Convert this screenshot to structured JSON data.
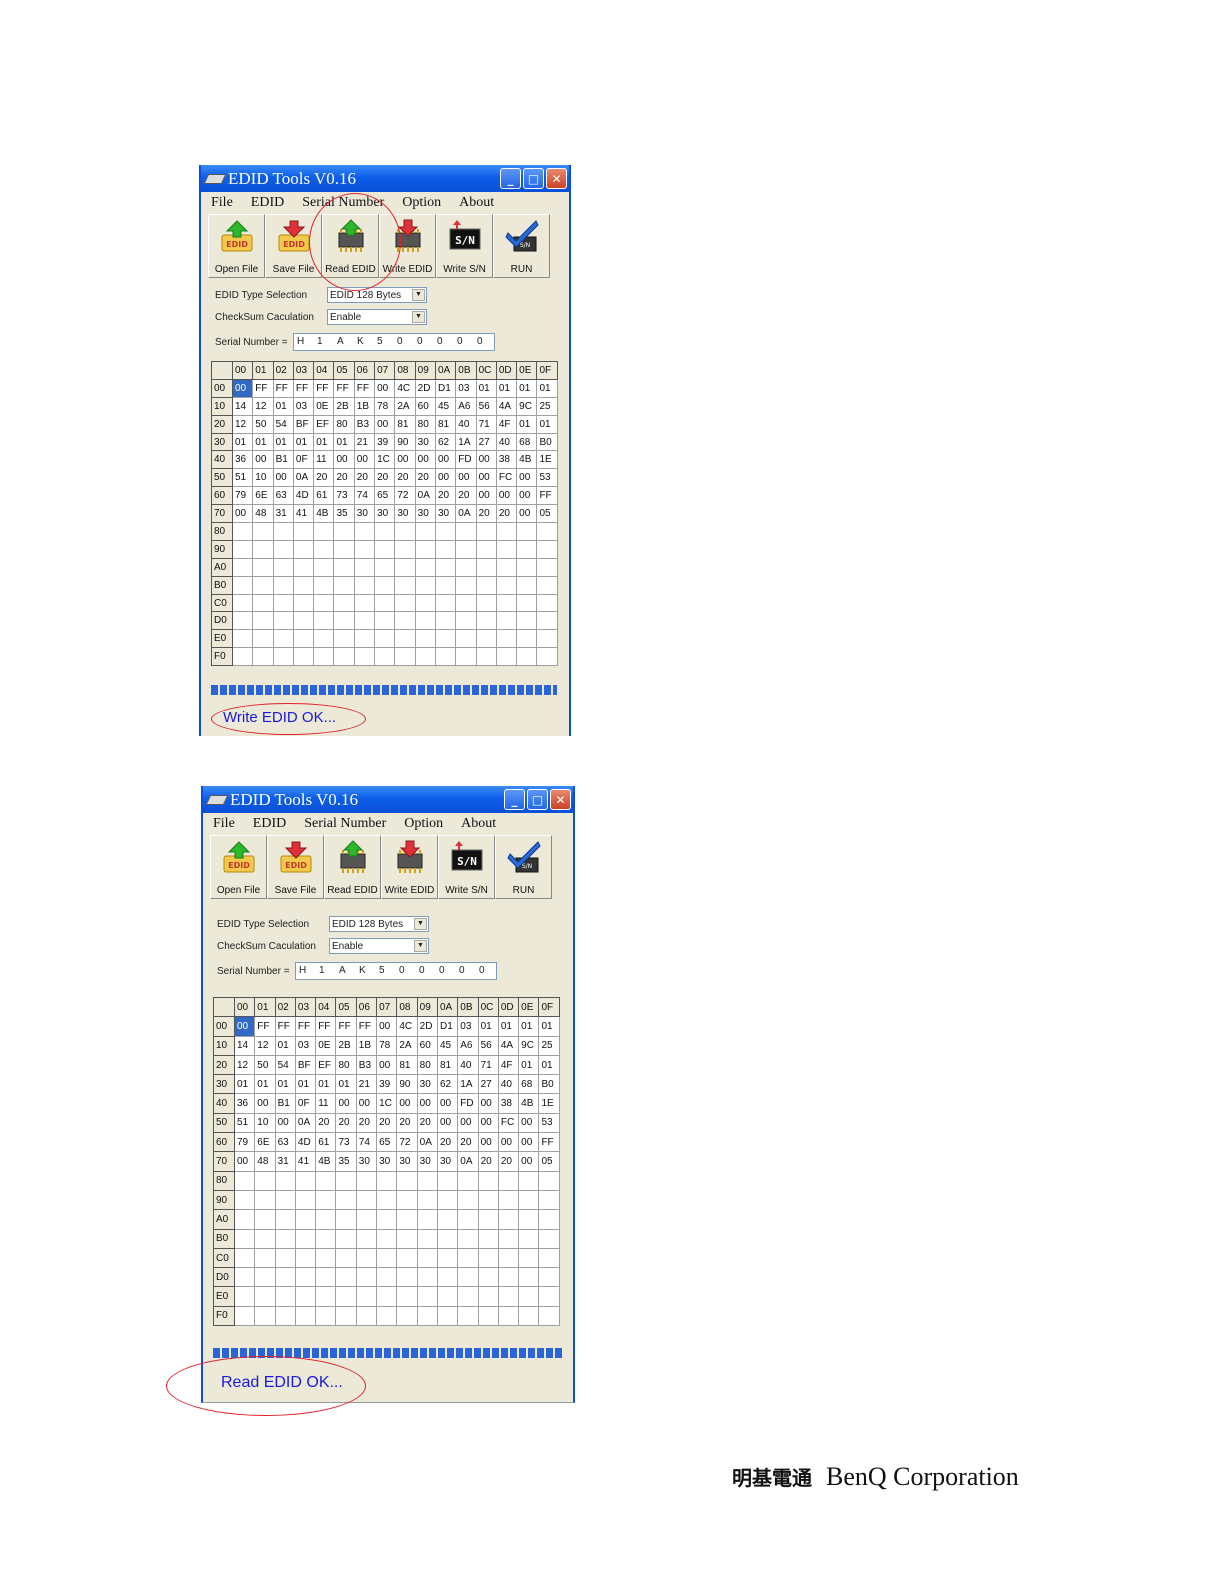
{
  "window_title": "EDID Tools V0.16",
  "menu": [
    "File",
    "EDID",
    "Serial Number",
    "Option",
    "About"
  ],
  "toolbar": [
    "Open File",
    "Save File",
    "Read EDID",
    "Write EDID",
    "Write S/N",
    "RUN"
  ],
  "form": {
    "type_label": "EDID Type Selection",
    "type_value": "EDID 128 Bytes",
    "checksum_label": "CheckSum Caculation",
    "checksum_value": "Enable",
    "serial_label": "Serial Number =",
    "serial_chars": [
      "H",
      "1",
      "A",
      "K",
      "5",
      "0",
      "0",
      "0",
      "0",
      "0"
    ]
  },
  "grid": {
    "col_headers": [
      "00",
      "01",
      "02",
      "03",
      "04",
      "05",
      "06",
      "07",
      "08",
      "09",
      "0A",
      "0B",
      "0C",
      "0D",
      "0E",
      "0F"
    ],
    "row_headers": [
      "00",
      "10",
      "20",
      "30",
      "40",
      "50",
      "60",
      "70",
      "80",
      "90",
      "A0",
      "B0",
      "C0",
      "D0",
      "E0",
      "F0"
    ],
    "rows": [
      [
        "00",
        "FF",
        "FF",
        "FF",
        "FF",
        "FF",
        "FF",
        "00",
        "4C",
        "2D",
        "D1",
        "03",
        "01",
        "01",
        "01",
        "01"
      ],
      [
        "14",
        "12",
        "01",
        "03",
        "0E",
        "2B",
        "1B",
        "78",
        "2A",
        "60",
        "45",
        "A6",
        "56",
        "4A",
        "9C",
        "25"
      ],
      [
        "12",
        "50",
        "54",
        "BF",
        "EF",
        "80",
        "B3",
        "00",
        "81",
        "80",
        "81",
        "40",
        "71",
        "4F",
        "01",
        "01"
      ],
      [
        "01",
        "01",
        "01",
        "01",
        "01",
        "01",
        "21",
        "39",
        "90",
        "30",
        "62",
        "1A",
        "27",
        "40",
        "68",
        "B0"
      ],
      [
        "36",
        "00",
        "B1",
        "0F",
        "11",
        "00",
        "00",
        "1C",
        "00",
        "00",
        "00",
        "FD",
        "00",
        "38",
        "4B",
        "1E"
      ],
      [
        "51",
        "10",
        "00",
        "0A",
        "20",
        "20",
        "20",
        "20",
        "20",
        "20",
        "00",
        "00",
        "00",
        "FC",
        "00",
        "53"
      ],
      [
        "79",
        "6E",
        "63",
        "4D",
        "61",
        "73",
        "74",
        "65",
        "72",
        "0A",
        "20",
        "20",
        "00",
        "00",
        "00",
        "FF"
      ],
      [
        "00",
        "48",
        "31",
        "41",
        "4B",
        "35",
        "30",
        "30",
        "30",
        "30",
        "30",
        "0A",
        "20",
        "20",
        "00",
        "05"
      ]
    ],
    "selected_cell": "00"
  },
  "status_top": "Write EDID OK...",
  "status_bottom": "Read EDID OK...",
  "footer": {
    "zh": "明基電通",
    "en": "BenQ Corporation"
  },
  "colors": {
    "title_bar": "#0a4fd6",
    "progress": "#2a64d8",
    "status_text": "#1a1adc",
    "annotation": "#e0222a",
    "window_bg": "#ece9d8"
  }
}
